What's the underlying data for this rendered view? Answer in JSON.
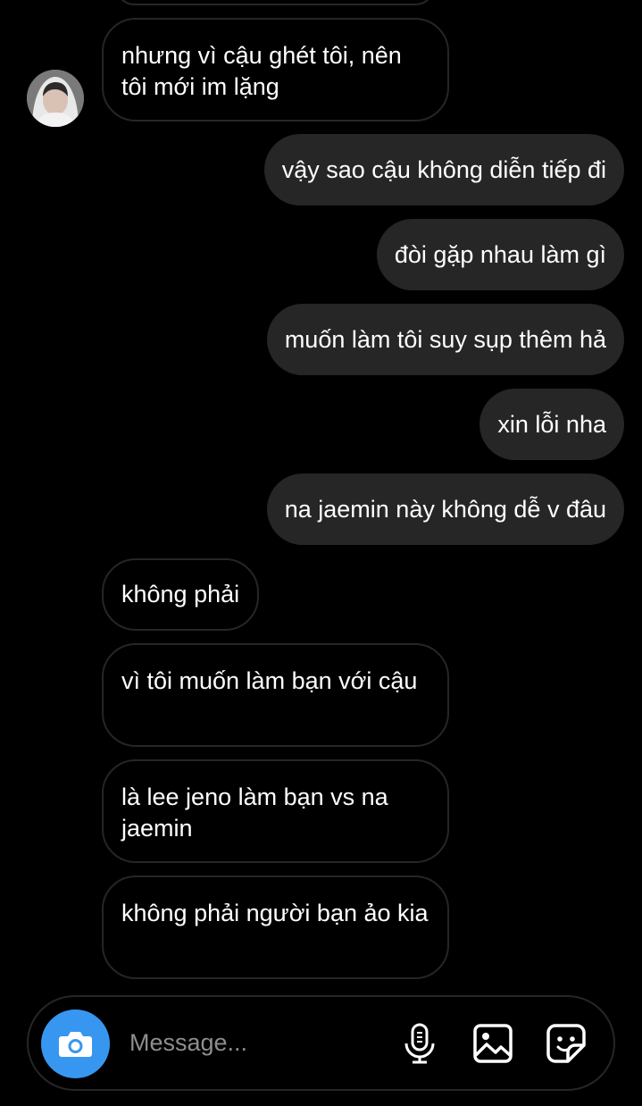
{
  "messages": [
    {
      "direction": "in",
      "text": "nhưng vì cậu ghét tôi, nên tôi mới im lặng"
    },
    {
      "direction": "out",
      "text": "vậy sao cậu không diễn tiếp đi"
    },
    {
      "direction": "out",
      "text": "đòi gặp nhau làm gì"
    },
    {
      "direction": "out",
      "text": "muốn làm tôi suy sụp thêm hả"
    },
    {
      "direction": "out",
      "text": "xin lỗi nha"
    },
    {
      "direction": "out",
      "text": "na jaemin này không dễ v đâu"
    },
    {
      "direction": "in",
      "text": "không phải"
    },
    {
      "direction": "in",
      "text": "vì tôi muốn làm bạn với cậu"
    },
    {
      "direction": "in",
      "text": "là lee jeno làm bạn vs na jaemin"
    },
    {
      "direction": "in",
      "text": "không phải người bạn ảo kia"
    }
  ],
  "composer": {
    "placeholder": "Message...",
    "camera_icon": "camera-icon",
    "mic_icon": "microphone-icon",
    "gallery_icon": "image-gallery-icon",
    "sticker_icon": "sticker-icon"
  },
  "colors": {
    "background": "#000000",
    "outgoing_bubble": "#262626",
    "incoming_border": "#262626",
    "accent": "#3797f0",
    "placeholder_text": "#8e8e8e"
  }
}
